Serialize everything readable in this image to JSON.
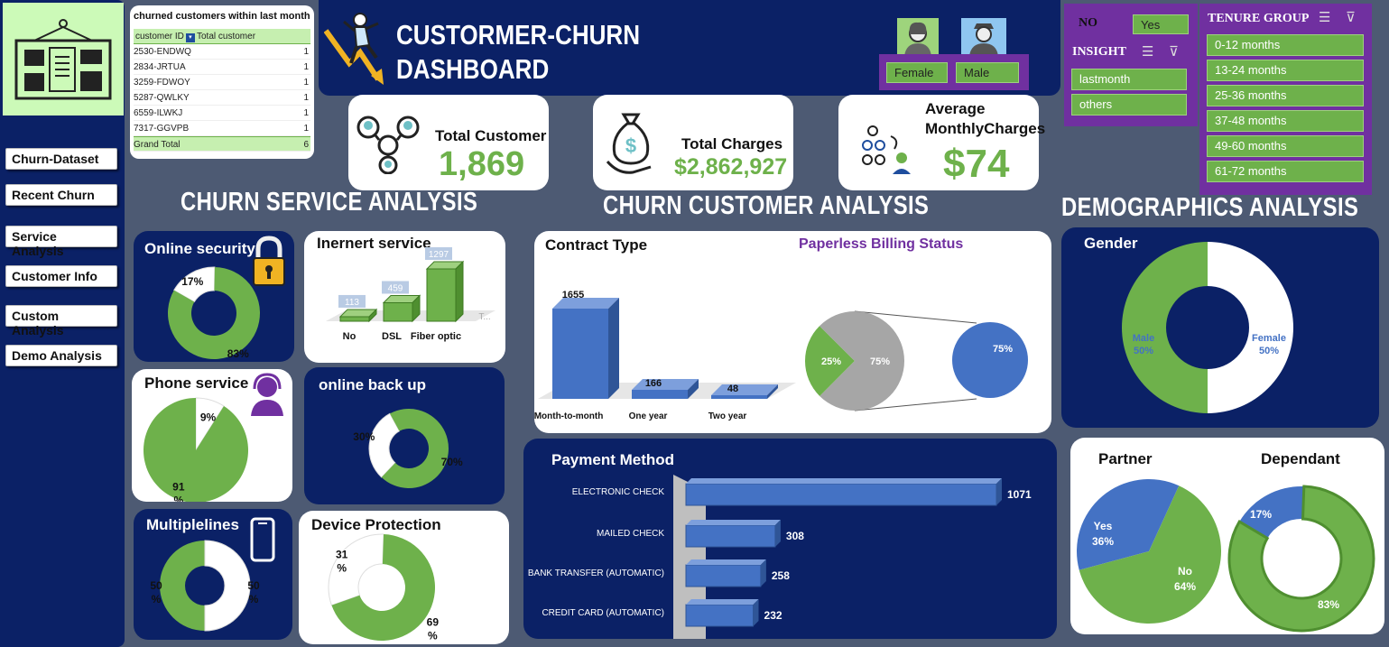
{
  "nav": [
    "Churn-Dataset",
    "Recent Churn",
    "Service Analysis",
    "Customer Info",
    "Custom Analysis",
    "Demo Analysis"
  ],
  "pivot": {
    "title": "churned customers within last month",
    "col1": "customer ID",
    "col2": "Total customer",
    "rows": [
      {
        "id": "2530-ENDWQ",
        "v": "1"
      },
      {
        "id": "2834-JRTUA",
        "v": "1"
      },
      {
        "id": "3259-FDWOY",
        "v": "1"
      },
      {
        "id": "5287-QWLKY",
        "v": "1"
      },
      {
        "id": "6559-ILWKJ",
        "v": "1"
      },
      {
        "id": "7317-GGVPB",
        "v": "1"
      }
    ],
    "grand_label": "Grand Total",
    "grand_value": "6"
  },
  "header": {
    "title1": "CUSTORMER-CHURN",
    "title2": "DASHBOARD"
  },
  "gender_slicer": {
    "female": "Female",
    "male": "Male"
  },
  "insight": {
    "no": "NO",
    "yes": "Yes",
    "title": "INSIGHT",
    "items": [
      "lastmonth",
      "others"
    ]
  },
  "tenure": {
    "title": "TENURE GROUP",
    "items": [
      "0-12 months",
      "13-24 months",
      "25-36 months",
      "37-48 months",
      "49-60 months",
      "61-72 months"
    ]
  },
  "kpis": {
    "total_customer_label": "Total Customer",
    "total_customer_value": "1,869",
    "total_charges_label": "Total Charges",
    "total_charges_value": "$2,862,927",
    "avg_label1": "Average",
    "avg_label2": "MonthlyCharges",
    "avg_value": "$74"
  },
  "sections": {
    "service": "CHURN SERVICE ANALYSIS",
    "customer": "CHURN CUSTOMER ANALYSIS",
    "demo": "DEMOGRAPHICS ANALYSIS"
  },
  "colors": {
    "navy": "#0b2166",
    "green": "#6eb14b",
    "blue": "#4472c4",
    "purple": "#7030a0",
    "bg": "#4d5a73"
  },
  "chart_data": [
    {
      "id": "online-security",
      "type": "pie",
      "title": "Online security",
      "slices": [
        {
          "label": "17%",
          "value": 17
        },
        {
          "label": "83%",
          "value": 83
        }
      ]
    },
    {
      "id": "internet-service",
      "type": "bar",
      "title": "Inernert service",
      "categories": [
        "No",
        "DSL",
        "Fiber optic"
      ],
      "values": [
        113,
        459,
        1297
      ],
      "trailing": "T..."
    },
    {
      "id": "phone-service",
      "type": "pie",
      "title": "Phone service",
      "slices": [
        {
          "label": "9%",
          "value": 9
        },
        {
          "label": "91 %",
          "value": 91
        }
      ]
    },
    {
      "id": "online-backup",
      "type": "pie",
      "title": "online back up",
      "slices": [
        {
          "label": "30%",
          "value": 30
        },
        {
          "label": "70%",
          "value": 70
        }
      ]
    },
    {
      "id": "multiplelines",
      "type": "pie",
      "title": "Multiplelines",
      "slices": [
        {
          "label": "50 %",
          "value": 50
        },
        {
          "label": "50 %",
          "value": 50
        }
      ]
    },
    {
      "id": "device-protection",
      "type": "pie",
      "title": "Device Protection",
      "slices": [
        {
          "label": "31 %",
          "value": 31
        },
        {
          "label": "69 %",
          "value": 69
        }
      ]
    },
    {
      "id": "contract-type",
      "type": "bar",
      "title": "Contract Type",
      "categories": [
        "Month-to-month",
        "One year",
        "Two year"
      ],
      "values": [
        1655,
        166,
        48
      ]
    },
    {
      "id": "paperless-billing",
      "type": "pie",
      "title": "Paperless Billing Status",
      "slices": [
        {
          "label": "25%",
          "value": 25
        },
        {
          "label": "75%",
          "value": 75
        }
      ],
      "secondary_label": "75%"
    },
    {
      "id": "payment-method",
      "type": "bar",
      "title": "Payment Method",
      "categories": [
        "ELECTRONIC CHECK",
        "MAILED CHECK",
        "BANK TRANSFER (AUTOMATIC)",
        "CREDIT CARD (AUTOMATIC)"
      ],
      "values": [
        1071,
        308,
        258,
        232
      ]
    },
    {
      "id": "gender",
      "type": "pie",
      "title": "Gender",
      "slices": [
        {
          "label": "Female",
          "pct": "50%",
          "value": 50
        },
        {
          "label": "Male",
          "pct": "50%",
          "value": 50
        }
      ]
    },
    {
      "id": "partner",
      "type": "pie",
      "title": "Partner",
      "slices": [
        {
          "label": "Yes",
          "pct": "36%",
          "value": 36
        },
        {
          "label": "No",
          "pct": "64%",
          "value": 64
        }
      ]
    },
    {
      "id": "dependant",
      "type": "pie",
      "title": "Dependant",
      "slices": [
        {
          "label": "17%",
          "value": 17
        },
        {
          "label": "83%",
          "value": 83
        }
      ]
    }
  ]
}
